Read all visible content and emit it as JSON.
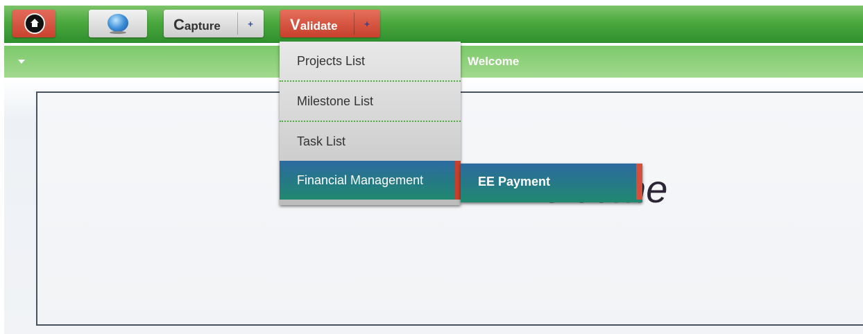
{
  "topbar": {
    "capture": {
      "initial": "C",
      "rest": "apture",
      "plus": "+"
    },
    "validate": {
      "initial": "V",
      "rest": "alidate",
      "plus": "+"
    }
  },
  "subbar": {
    "title": "Welcome"
  },
  "content": {
    "welcome": "Welcome"
  },
  "menu": {
    "items": [
      {
        "label": "Projects List"
      },
      {
        "label": "Milestone List"
      },
      {
        "label": "Task List"
      },
      {
        "label": "Financial Management"
      }
    ]
  },
  "submenu": {
    "items": [
      {
        "label": "EE Payment"
      }
    ]
  },
  "colors": {
    "accent_green": "#4aa83e",
    "validate_red": "#c7402c",
    "menu_highlight": "#2c6aa0"
  },
  "icons": {
    "home": "home-icon",
    "globe": "globe-icon",
    "dropdown": "caret-down-icon"
  }
}
